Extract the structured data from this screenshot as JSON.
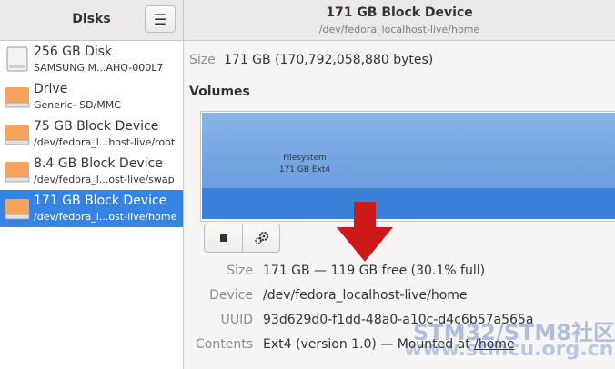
{
  "sidebar": {
    "title": "Disks",
    "menu_icon": "hamburger-menu-icon",
    "items": [
      {
        "name": "256 GB Disk",
        "sub": "SAMSUNG M...AHQ-000L7",
        "icon": "ssd-drive-icon"
      },
      {
        "name": "Drive",
        "sub": "Generic- SD/MMC",
        "icon": "block-device-icon"
      },
      {
        "name": "75 GB Block Device",
        "sub": "/dev/fedora_l...host-live/root",
        "icon": "block-device-icon"
      },
      {
        "name": "8.4 GB Block Device",
        "sub": "/dev/fedora_l...ost-live/swap",
        "icon": "block-device-icon"
      },
      {
        "name": "171 GB Block Device",
        "sub": "/dev/fedora_l...ost-live/home",
        "icon": "block-device-icon",
        "selected": true
      }
    ]
  },
  "header": {
    "title": "171 GB Block Device",
    "subtitle": "/dev/fedora_localhost-live/home"
  },
  "device_info": {
    "size_label": "Size",
    "size_value": "171 GB (170,792,058,880 bytes)"
  },
  "volumes": {
    "heading": "Volumes",
    "partition_label": "Filesystem",
    "partition_size": "171 GB Ext4",
    "toolbar": {
      "stop_icon": "stop-icon",
      "settings_icon": "gears-icon"
    }
  },
  "volume_details": [
    {
      "label": "Size",
      "value": "171 GB — 119 GB free (30.1% full)"
    },
    {
      "label": "Device",
      "value": "/dev/fedora_localhost-live/home"
    },
    {
      "label": "UUID",
      "value": "93d629d0-f1dd-48a0-a10c-d4c6b57a565a"
    },
    {
      "label": "Contents",
      "value": "Ext4 (version 1.0) — Mounted at ",
      "link": "/home"
    }
  ],
  "annotation": {
    "arrow_icon": "red-down-arrow-icon",
    "color": "#cc1a1a"
  },
  "watermark": {
    "line1": "STM32/STM8社区",
    "line2": "www.stmcu.org.cn"
  },
  "colors": {
    "accent": "#3584e4",
    "partition": "#6a9ddf"
  }
}
